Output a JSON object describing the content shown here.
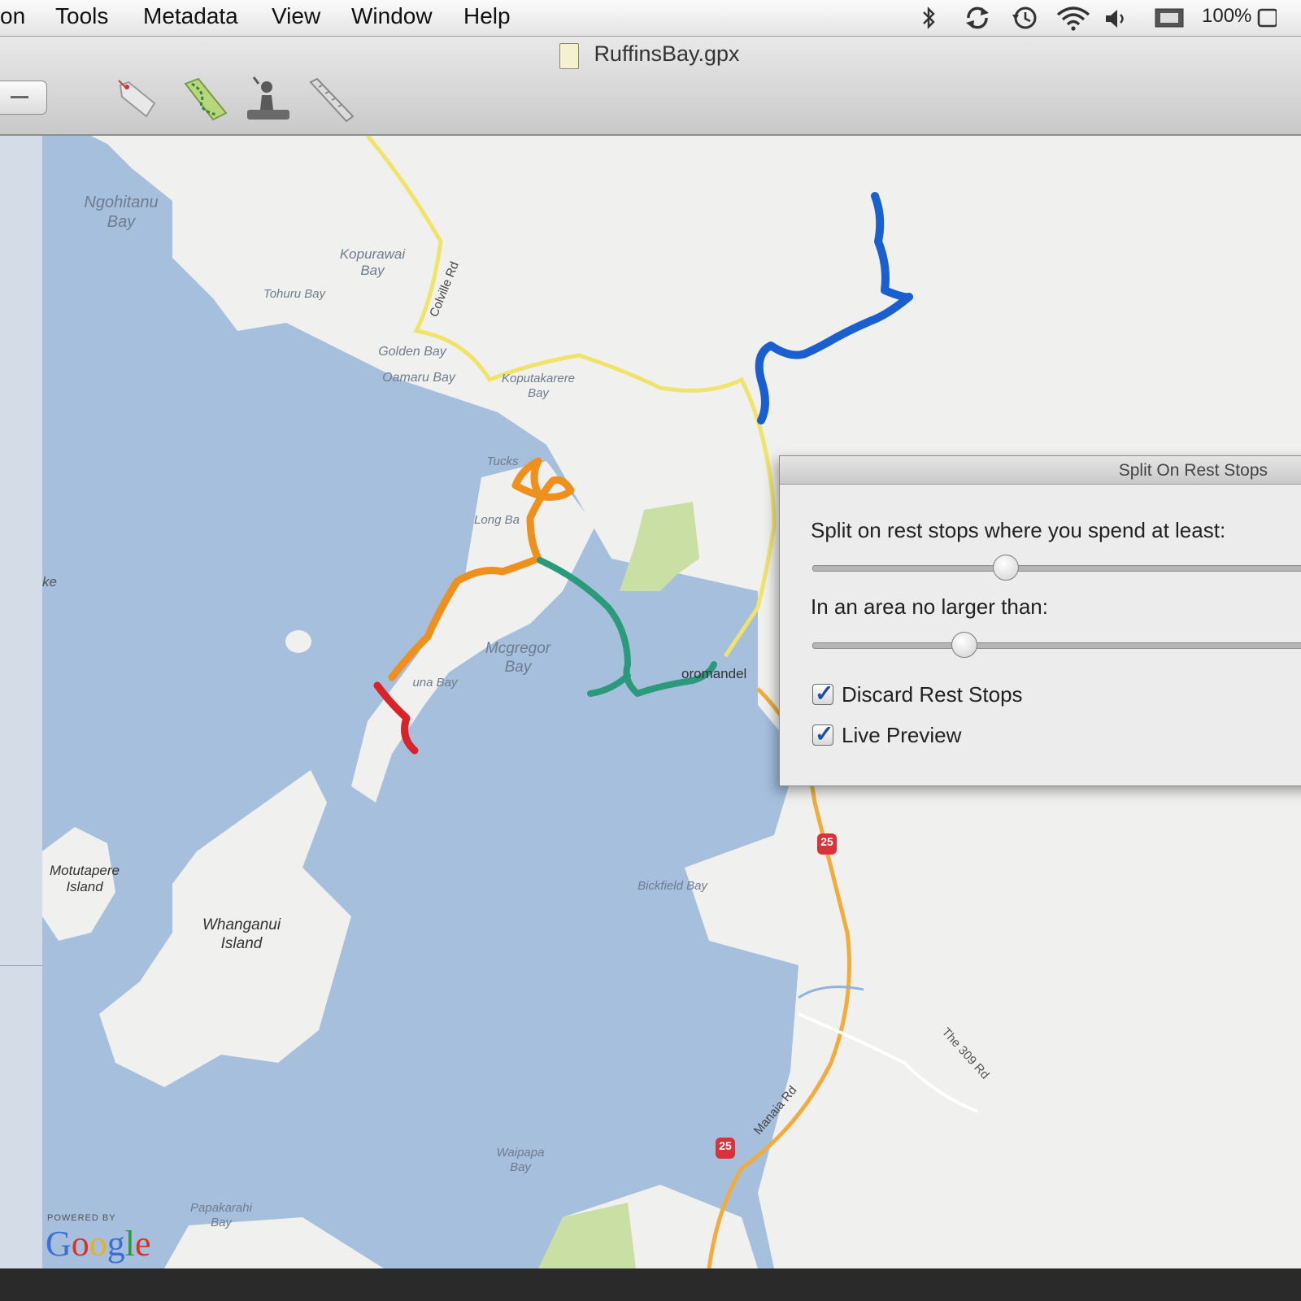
{
  "menubar": {
    "items": [
      "on",
      "Tools",
      "Metadata",
      "View",
      "Window",
      "Help"
    ],
    "battery": "100%"
  },
  "window": {
    "title": "RuffinsBay.gpx"
  },
  "map": {
    "labels": {
      "ngohitanu": "Ngohitanu Bay",
      "kopurawai": "Kopurawai Bay",
      "tohuru": "Tohuru Bay",
      "golden": "Golden Bay",
      "oamaru": "Oamaru Bay",
      "koputakarere": "Koputakarere Bay",
      "tucks": "Tucks",
      "long_bay": "Long Ba",
      "mcgregor": "Mcgregor Bay",
      "luna": "una Bay",
      "coromandel": "oromandel",
      "motutapere": "Motutapere Island",
      "whanganui": "Whanganui Island",
      "bickfield": "Bickfield Bay",
      "waipapa": "Waipapa Bay",
      "papakarahi": "Papakarahi Bay",
      "colville_rd": "Colville Rd",
      "manaia_rd": "Manaia Rd",
      "the_309_rd": "The 309 Rd",
      "route_25a": "25",
      "route_25b": "25",
      "rd_edge": "Rd",
      "lake": "ke"
    },
    "attribution": {
      "powered_by": "POWERED BY",
      "google": "Google"
    },
    "track_colors": {
      "blue": "#1a5fd0",
      "orange": "#f0901c",
      "green": "#2a9a7a",
      "red": "#d8232a"
    }
  },
  "panel": {
    "title": "Split On Rest Stops",
    "label_time": "Split on rest stops where you spend at least:",
    "label_area": "In an area no larger than:",
    "slider_time_value": 0.37,
    "slider_area_value": 0.29,
    "discard_label": "Discard Rest Stops",
    "discard_checked": true,
    "preview_label": "Live Preview",
    "preview_checked": true
  }
}
